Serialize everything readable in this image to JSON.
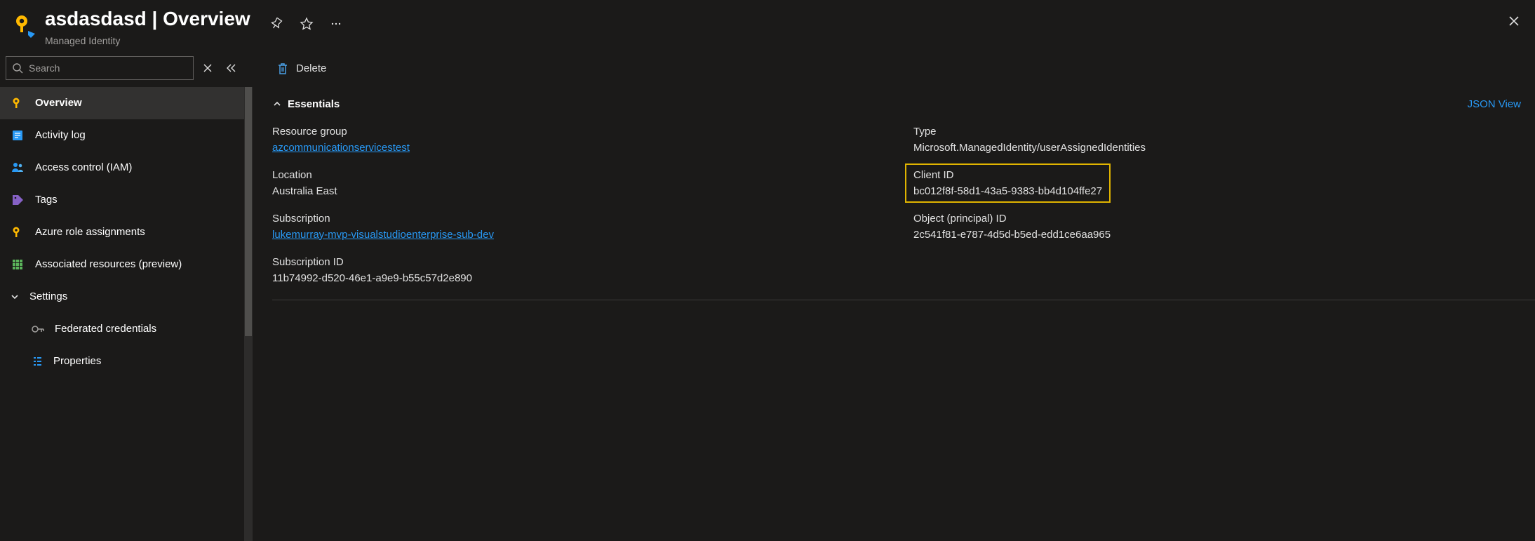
{
  "header": {
    "resource_name": "asdasdasd",
    "section": "Overview",
    "title_separator": " | ",
    "subtitle": "Managed Identity"
  },
  "search": {
    "placeholder": "Search"
  },
  "sidebar": {
    "items": [
      {
        "label": "Overview"
      },
      {
        "label": "Activity log"
      },
      {
        "label": "Access control (IAM)"
      },
      {
        "label": "Tags"
      },
      {
        "label": "Azure role assignments"
      },
      {
        "label": "Associated resources (preview)"
      }
    ],
    "settings_group_label": "Settings",
    "subitems": [
      {
        "label": "Federated credentials"
      },
      {
        "label": "Properties"
      }
    ]
  },
  "toolbar": {
    "delete_label": "Delete"
  },
  "essentials": {
    "header_label": "Essentials",
    "json_view_label": "JSON View",
    "left": {
      "resource_group_label": "Resource group",
      "resource_group_value": "azcommunicationservicestest",
      "location_label": "Location",
      "location_value": "Australia East",
      "subscription_label": "Subscription",
      "subscription_value": "lukemurray-mvp-visualstudioenterprise-sub-dev",
      "subscription_id_label": "Subscription ID",
      "subscription_id_value": "11b74992-d520-46e1-a9e9-b55c57d2e890"
    },
    "right": {
      "type_label": "Type",
      "type_value": "Microsoft.ManagedIdentity/userAssignedIdentities",
      "client_id_label": "Client ID",
      "client_id_value": "bc012f8f-58d1-43a5-9383-bb4d104ffe27",
      "object_id_label": "Object (principal) ID",
      "object_id_value": "2c541f81-e787-4d5d-b5ed-edd1ce6aa965"
    }
  }
}
